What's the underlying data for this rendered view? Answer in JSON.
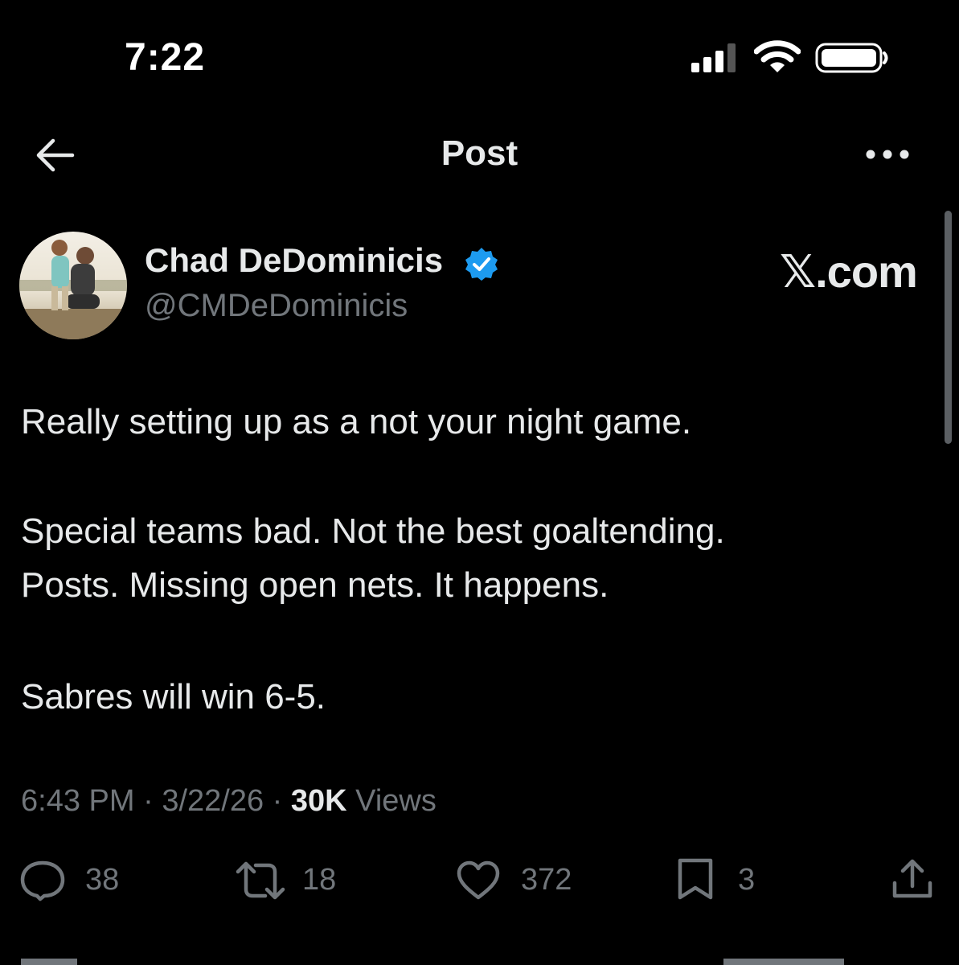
{
  "status_bar": {
    "time": "7:22"
  },
  "header": {
    "title": "Post"
  },
  "author": {
    "name": "Chad DeDominicis",
    "handle": "@CMDeDominicis",
    "verified": true
  },
  "watermark": "𝕏.com",
  "post": {
    "lines": [
      "Really setting up as a not your night game.",
      "Special teams bad. Not the best goaltending.",
      "Posts. Missing open nets. It happens.",
      "Sabres will win 6-5."
    ]
  },
  "meta": {
    "time": "6:43 PM",
    "date": "3/22/26",
    "views_count": "30K",
    "views_label": "Views",
    "separator": "·"
  },
  "actions": {
    "replies": "38",
    "reposts": "18",
    "likes": "372",
    "bookmarks": "3"
  },
  "colors": {
    "background": "#000000",
    "text": "#e7e9ea",
    "secondary": "#71767b",
    "verified_badge": "#1d9bf0"
  }
}
